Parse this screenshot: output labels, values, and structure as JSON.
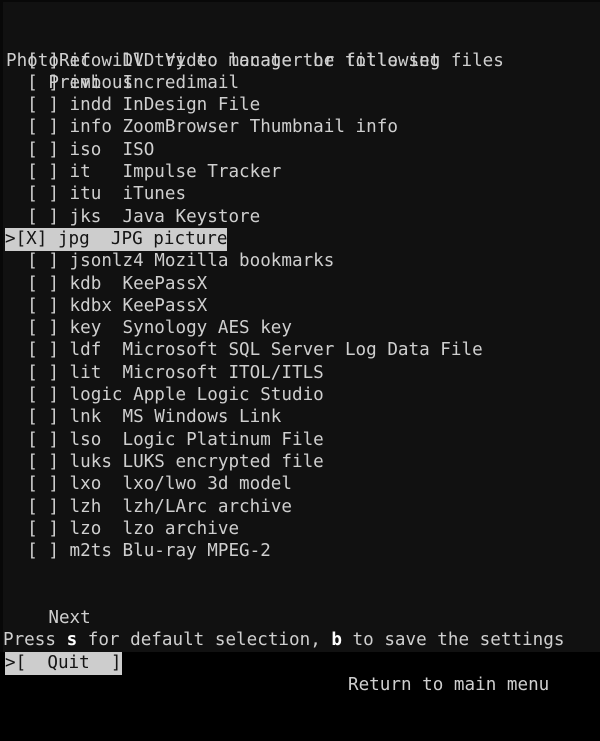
{
  "app": {
    "name": "PhotoRec",
    "header": "PhotoRec will try to locate the following files",
    "background_color": "#111111",
    "text_color": "#cfcfcf",
    "highlight_background": "#cdcdcd",
    "highlight_text": "#141414"
  },
  "nav": {
    "previous_label": "    Previous",
    "previous_text": "Previous",
    "next_label": "    Next",
    "next_text": "Next"
  },
  "file_list": {
    "unchecked_mark": "[ ]",
    "checked_mark": "[X]",
    "cursor_mark": ">",
    "items": [
      {
        "checked": false,
        "selected": false,
        "ext": "ifo",
        "desc": "DVD Video manager or title set",
        "line": "  [ ] ifo  DVD Video manager or title set"
      },
      {
        "checked": false,
        "selected": false,
        "ext": "imb",
        "desc": "Incredimail",
        "line": "  [ ] imb  Incredimail"
      },
      {
        "checked": false,
        "selected": false,
        "ext": "indd",
        "desc": "InDesign File",
        "line": "  [ ] indd InDesign File"
      },
      {
        "checked": false,
        "selected": false,
        "ext": "info",
        "desc": "ZoomBrowser Thumbnail info",
        "line": "  [ ] info ZoomBrowser Thumbnail info"
      },
      {
        "checked": false,
        "selected": false,
        "ext": "iso",
        "desc": "ISO",
        "line": "  [ ] iso  ISO"
      },
      {
        "checked": false,
        "selected": false,
        "ext": "it",
        "desc": "Impulse Tracker",
        "line": "  [ ] it   Impulse Tracker"
      },
      {
        "checked": false,
        "selected": false,
        "ext": "itu",
        "desc": "iTunes",
        "line": "  [ ] itu  iTunes"
      },
      {
        "checked": false,
        "selected": false,
        "ext": "jks",
        "desc": "Java Keystore",
        "line": "  [ ] jks  Java Keystore"
      },
      {
        "checked": true,
        "selected": true,
        "ext": "jpg",
        "desc": "JPG picture",
        "line": ">[X] jpg  JPG picture"
      },
      {
        "checked": false,
        "selected": false,
        "ext": "jsonlz4",
        "desc": "Mozilla bookmarks",
        "line": "  [ ] jsonlz4 Mozilla bookmarks"
      },
      {
        "checked": false,
        "selected": false,
        "ext": "kdb",
        "desc": "KeePassX",
        "line": "  [ ] kdb  KeePassX"
      },
      {
        "checked": false,
        "selected": false,
        "ext": "kdbx",
        "desc": "KeePassX",
        "line": "  [ ] kdbx KeePassX"
      },
      {
        "checked": false,
        "selected": false,
        "ext": "key",
        "desc": "Synology AES key",
        "line": "  [ ] key  Synology AES key"
      },
      {
        "checked": false,
        "selected": false,
        "ext": "ldf",
        "desc": "Microsoft SQL Server Log Data File",
        "line": "  [ ] ldf  Microsoft SQL Server Log Data File"
      },
      {
        "checked": false,
        "selected": false,
        "ext": "lit",
        "desc": "Microsoft ITOL/ITLS",
        "line": "  [ ] lit  Microsoft ITOL/ITLS"
      },
      {
        "checked": false,
        "selected": false,
        "ext": "logic",
        "desc": "Apple Logic Studio",
        "line": "  [ ] logic Apple Logic Studio"
      },
      {
        "checked": false,
        "selected": false,
        "ext": "lnk",
        "desc": "MS Windows Link",
        "line": "  [ ] lnk  MS Windows Link"
      },
      {
        "checked": false,
        "selected": false,
        "ext": "lso",
        "desc": "Logic Platinum File",
        "line": "  [ ] lso  Logic Platinum File"
      },
      {
        "checked": false,
        "selected": false,
        "ext": "luks",
        "desc": "LUKS encrypted file",
        "line": "  [ ] luks LUKS encrypted file"
      },
      {
        "checked": false,
        "selected": false,
        "ext": "lxo",
        "desc": "lxo/lwo 3d model",
        "line": "  [ ] lxo  lxo/lwo 3d model"
      },
      {
        "checked": false,
        "selected": false,
        "ext": "lzh",
        "desc": "lzh/LArc archive",
        "line": "  [ ] lzh  lzh/LArc archive"
      },
      {
        "checked": false,
        "selected": false,
        "ext": "lzo",
        "desc": "lzo archive",
        "line": "  [ ] lzo  lzo archive"
      },
      {
        "checked": false,
        "selected": false,
        "ext": "m2ts",
        "desc": "Blu-ray MPEG-2",
        "line": "  [ ] m2ts Blu-ray MPEG-2"
      }
    ]
  },
  "footer": {
    "hint_part1": "Press ",
    "hint_key_s": "s",
    "hint_part2": " for default selection, ",
    "hint_key_b": "b",
    "hint_part3": " to save the settings",
    "quit_cursor": ">",
    "quit_button": "[  Quit  ]",
    "quit_label": "Quit",
    "return_text": "Return to main menu"
  }
}
